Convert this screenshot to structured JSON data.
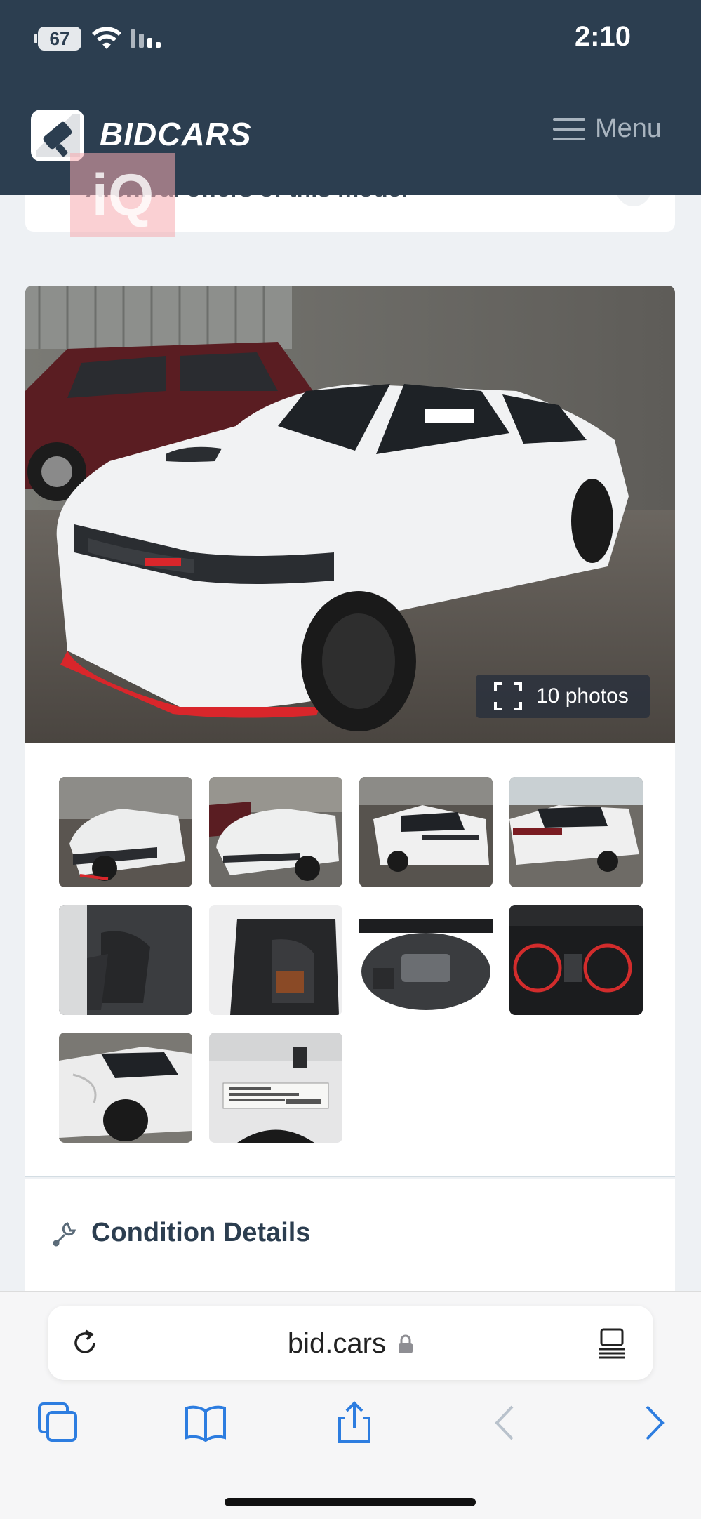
{
  "status_bar": {
    "battery": "67",
    "time": "2:10"
  },
  "header": {
    "brand": "BIDCARS",
    "menu_label": "Menu"
  },
  "prev_card": {
    "text": "Archival offers of this model"
  },
  "watermark": {
    "text": "iQ"
  },
  "gallery": {
    "photos_button": "10 photos",
    "thumbnails": [
      "front-left exterior",
      "front view in warehouse",
      "rear-left exterior",
      "rear-right exterior",
      "front interior seats",
      "rear interior seats",
      "engine bay",
      "instrument cluster",
      "damaged rear quarter",
      "door jamb label"
    ]
  },
  "condition": {
    "title": "Condition Details"
  },
  "browser": {
    "url": "bid.cars"
  }
}
